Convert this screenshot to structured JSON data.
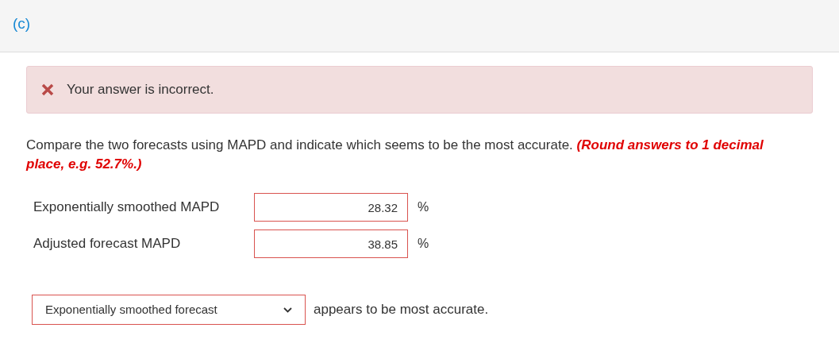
{
  "part_label": "(c)",
  "feedback": {
    "correct": false,
    "text": "Your answer is incorrect."
  },
  "instruction": "Compare the two forecasts using MAPD and indicate which seems to be the most accurate. **(Round answers to 1 decimal place, e.g. 52.7%.)**",
  "fields": [
    {
      "label": "Exponentially smoothed MAPD",
      "value": "28.32",
      "unit": "%",
      "invalid": true
    },
    {
      "label": "Adjusted forecast MAPD",
      "value": "38.85",
      "unit": "%",
      "invalid": true
    }
  ],
  "answer_select": {
    "value": "Exponentially smoothed forecast",
    "invalid": true,
    "suffix": "appears to be most accurate."
  }
}
